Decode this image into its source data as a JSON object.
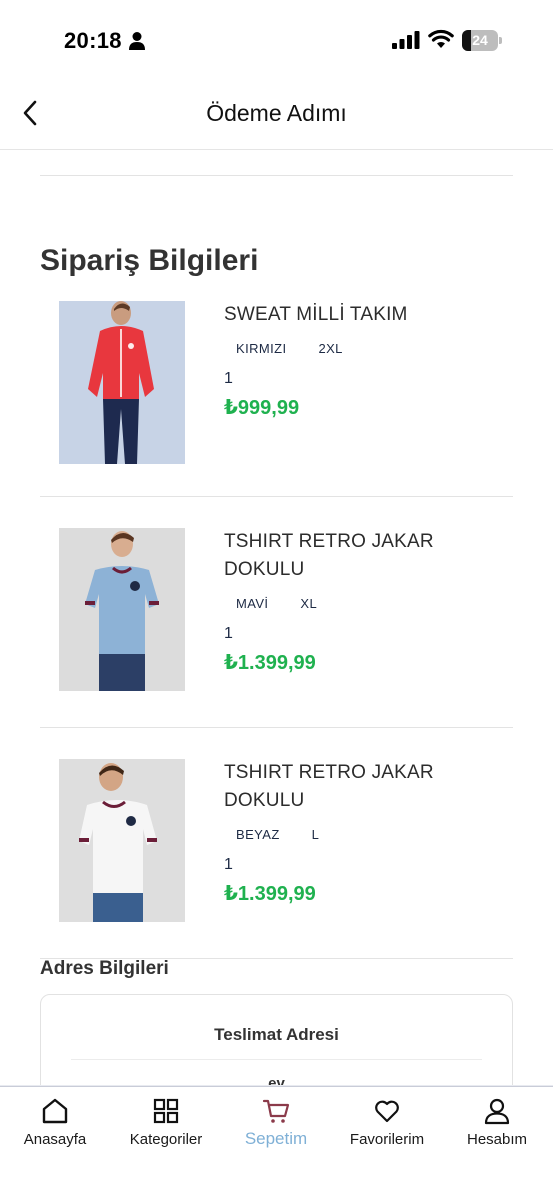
{
  "status_bar": {
    "time": "20:18",
    "battery": "24",
    "battery_level": 0.24
  },
  "header": {
    "title": "Ödeme Adımı"
  },
  "order": {
    "title": "Sipariş Bilgileri",
    "items": [
      {
        "name": "SWEAT MİLLİ TAKIM",
        "color": "KIRMIZI",
        "size": "2XL",
        "quantity": "1",
        "price": "₺999,99",
        "shirt_color": "#e8373e",
        "bg_color": "#c7d3e6"
      },
      {
        "name": "TSHIRT RETRO JAKAR DOKULU",
        "color": "MAVİ",
        "size": "XL",
        "quantity": "1",
        "price": "₺1.399,99",
        "shirt_color": "#8db2d6",
        "bg_color": "#dcdcdc"
      },
      {
        "name": "TSHIRT RETRO JAKAR DOKULU",
        "color": "BEYAZ",
        "size": "L",
        "quantity": "1",
        "price": "₺1.399,99",
        "shirt_color": "#f6f6f6",
        "bg_color": "#dedede"
      }
    ]
  },
  "address": {
    "title": "Adres Bilgileri",
    "card_title": "Teslimat Adresi",
    "card_value": "ev"
  },
  "tab_bar": {
    "tabs": [
      {
        "label": "Anasayfa",
        "icon": "home-icon"
      },
      {
        "label": "Kategoriler",
        "icon": "grid-icon"
      },
      {
        "label": "Sepetim",
        "icon": "cart-icon",
        "active": true
      },
      {
        "label": "Favorilerim",
        "icon": "heart-icon"
      },
      {
        "label": "Hesabım",
        "icon": "user-icon"
      }
    ]
  },
  "colors": {
    "price": "#1fb14f",
    "active_tab": "#7fb0d6",
    "cart_icon": "#8b3a4a"
  }
}
